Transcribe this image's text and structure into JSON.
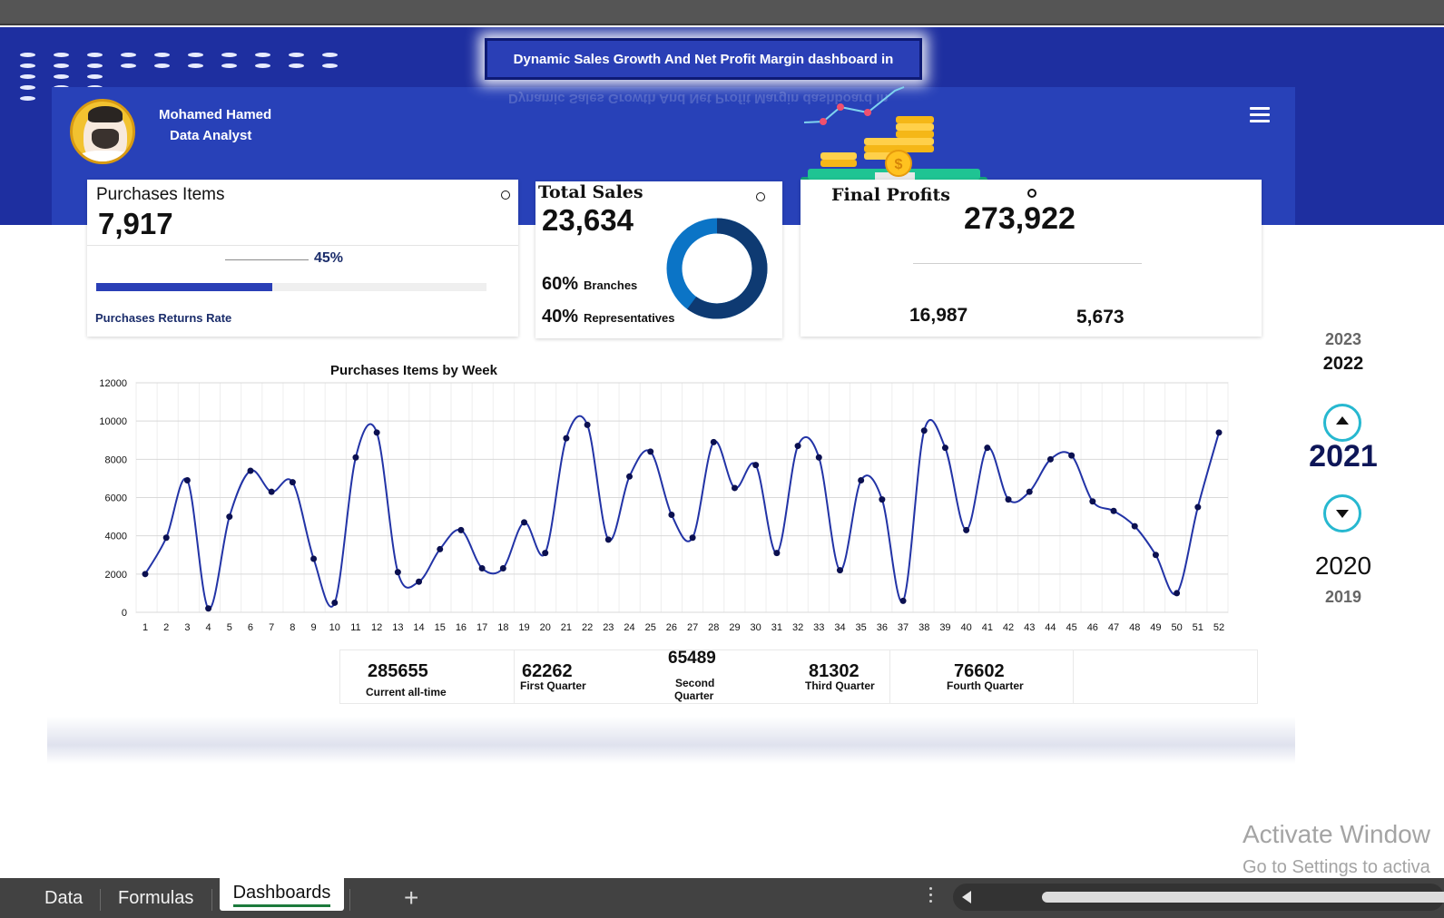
{
  "header": {
    "title": "Dynamic Sales Growth And Net Profit Margin dashboard in",
    "user_name": "Mohamed Hamed",
    "user_role": "Data Analyst"
  },
  "purchases_card": {
    "title": "Purchases Items",
    "value": "7,917",
    "return_rate_pct": "45%",
    "return_rate_fraction": 0.45,
    "bar_label": "Purchases Returns Rate"
  },
  "sales_card": {
    "title": "Total Sales",
    "value": "23,634",
    "branches_pct": "60%",
    "branches_label": "Branches",
    "reps_pct": "40%",
    "reps_label": "Representatives",
    "branches_fraction": 0.6,
    "colors": {
      "branches": "#0e3a72",
      "representatives": "#0b74c6"
    }
  },
  "profits_card": {
    "title": "Final Profits",
    "value": "273,922",
    "sub_left": "16,987",
    "sub_right": "5,673"
  },
  "year_selector": {
    "year_2023": "2023",
    "year_2022": "2022",
    "selected": "2021",
    "year_2020": "2020",
    "year_2019": "2019"
  },
  "chart_data": {
    "type": "line",
    "title": "Purchases Items by Week",
    "x": [
      1,
      2,
      3,
      4,
      5,
      6,
      7,
      8,
      9,
      10,
      11,
      12,
      13,
      14,
      15,
      16,
      17,
      18,
      19,
      20,
      21,
      22,
      23,
      24,
      25,
      26,
      27,
      28,
      29,
      30,
      31,
      32,
      33,
      34,
      35,
      36,
      37,
      38,
      39,
      40,
      41,
      42,
      43,
      44,
      45,
      46,
      47,
      48,
      49,
      50,
      51,
      52
    ],
    "values": [
      2000,
      3900,
      6900,
      200,
      5000,
      7400,
      6300,
      6800,
      2800,
      500,
      8100,
      9400,
      2100,
      1600,
      3300,
      4300,
      2300,
      2300,
      4700,
      3100,
      9100,
      9800,
      3800,
      7100,
      8400,
      5100,
      3900,
      8900,
      6500,
      7700,
      3100,
      8700,
      8100,
      2200,
      6900,
      5900,
      600,
      9500,
      8600,
      4300,
      8600,
      5900,
      6300,
      8000,
      8200,
      5800,
      5300,
      4500,
      3000,
      1000,
      5500,
      9400
    ],
    "ylim": [
      0,
      12000
    ],
    "yticks": [
      "0",
      "2000",
      "4000",
      "6000",
      "8000",
      "10000",
      "12000"
    ],
    "grid": true,
    "color": "#2233a6"
  },
  "quarters": {
    "all_time_value": "285655",
    "all_time_label": "Current all-time",
    "q1_value": "62262",
    "q1_label": "First Quarter",
    "q2_value": "65489",
    "q2_label_line1": "Second",
    "q2_label_line2": "Quarter",
    "q3_value": "81302",
    "q3_label": "Third Quarter",
    "q4_value": "76602",
    "q4_label": "Fourth Quarter"
  },
  "watermark": {
    "line1": "Activate Window",
    "line2": "Go to Settings to activa"
  },
  "sheet_tabs": {
    "data": "Data",
    "formulas": "Formulas",
    "dashboards": "Dashboards",
    "add": "+"
  }
}
